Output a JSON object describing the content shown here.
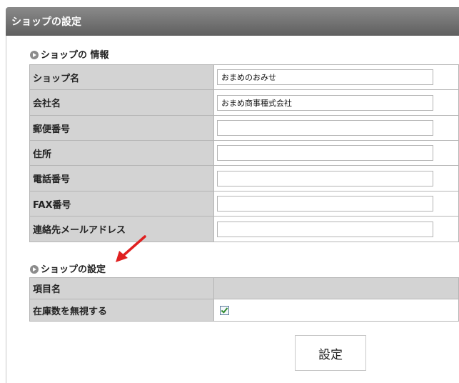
{
  "window": {
    "title": "ショップの設定"
  },
  "info_section": {
    "heading": "ショップの 情報",
    "rows": [
      {
        "label": "ショップ名",
        "value": "おまめのおみせ"
      },
      {
        "label": "会社名",
        "value": "おまめ商事種式会社"
      },
      {
        "label": "郵便番号",
        "value": ""
      },
      {
        "label": "住所",
        "value": ""
      },
      {
        "label": "電話番号",
        "value": ""
      },
      {
        "label": "FAX番号",
        "value": ""
      },
      {
        "label": "連絡先メールアドレス",
        "value": ""
      }
    ]
  },
  "settings_section": {
    "heading": "ショップの設定",
    "header_label": "項目名",
    "rows": [
      {
        "label": "在庫数を無視する",
        "checked": true
      }
    ]
  },
  "submit": {
    "label": "設定"
  },
  "colors": {
    "annotation_arrow": "#e02020"
  }
}
